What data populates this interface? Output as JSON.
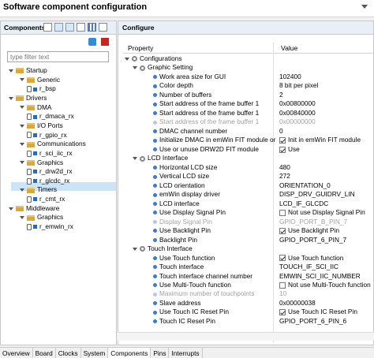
{
  "window": {
    "title": "Software component configuration"
  },
  "components": {
    "header": "Components",
    "filter_placeholder": "type filter text",
    "tree": [
      {
        "label": "Startup",
        "kind": "folder",
        "level": 1
      },
      {
        "label": "Generic",
        "kind": "folder",
        "level": 2
      },
      {
        "label": "r_bsp",
        "kind": "comp",
        "level": 3
      },
      {
        "label": "Drivers",
        "kind": "folder",
        "level": 1
      },
      {
        "label": "DMA",
        "kind": "folder",
        "level": 2
      },
      {
        "label": "r_dmaca_rx",
        "kind": "comp",
        "level": 3
      },
      {
        "label": "I/O Ports",
        "kind": "folder",
        "level": 2
      },
      {
        "label": "r_gpio_rx",
        "kind": "comp",
        "level": 3
      },
      {
        "label": "Communications",
        "kind": "folder",
        "level": 2
      },
      {
        "label": "r_sci_iic_rx",
        "kind": "comp",
        "level": 3
      },
      {
        "label": "Graphics",
        "kind": "folder",
        "level": 2
      },
      {
        "label": "r_drw2d_rx",
        "kind": "comp",
        "level": 3
      },
      {
        "label": "r_glcdc_rx",
        "kind": "comp",
        "level": 3
      },
      {
        "label": "Timers",
        "kind": "folder",
        "level": 2,
        "selected": true
      },
      {
        "label": "r_cmt_rx",
        "kind": "comp",
        "level": 3
      },
      {
        "label": "Middleware",
        "kind": "folder",
        "level": 1
      },
      {
        "label": "Graphics",
        "kind": "folder",
        "level": 2
      },
      {
        "label": "r_emwin_rx",
        "kind": "comp",
        "level": 3
      }
    ]
  },
  "configure": {
    "header": "Configure",
    "col_property": "Property",
    "col_value": "Value",
    "rows": [
      {
        "label": "Configurations",
        "type": "group",
        "level": 0
      },
      {
        "label": "Graphic Setting",
        "type": "group",
        "level": 1
      },
      {
        "label": "Work area size for GUI",
        "value": "102400",
        "level": 2
      },
      {
        "label": "Color depth",
        "value": "8 bit per pixel",
        "level": 2
      },
      {
        "label": "Number of buffers",
        "value": "2",
        "level": 2
      },
      {
        "label": "Start address of the frame buffer 1",
        "value": "0x00800000",
        "level": 2
      },
      {
        "label": "Start address of the frame buffer 1",
        "value": "0x00840000",
        "level": 2
      },
      {
        "label": "Start address of the frame buffer 1",
        "value": "0x00000000",
        "level": 2,
        "disabled": true
      },
      {
        "label": "DMAC channel number",
        "value": "0",
        "level": 2
      },
      {
        "label": "Initialize DMAC in emWin FIT module or not",
        "value": "Init in emWin FIT module",
        "checkbox": true,
        "checked": true,
        "level": 2
      },
      {
        "label": "Use or unuse DRW2D FIT module",
        "value": "Use",
        "checkbox": true,
        "checked": true,
        "level": 2
      },
      {
        "label": "LCD Interface",
        "type": "group",
        "level": 1
      },
      {
        "label": "Horizontal LCD size",
        "value": "480",
        "level": 2
      },
      {
        "label": "Vertical LCD size",
        "value": "272",
        "level": 2
      },
      {
        "label": "LCD orientation",
        "value": "ORIENTATION_0",
        "level": 2
      },
      {
        "label": "emWin display driver",
        "value": "DISP_DRV_GUIDRV_LIN",
        "level": 2
      },
      {
        "label": "LCD interface",
        "value": "LCD_IF_GLCDC",
        "level": 2
      },
      {
        "label": "Use Display Signal Pin",
        "value": "Not use Display Signal Pin",
        "checkbox": true,
        "checked": false,
        "level": 2
      },
      {
        "label": "Display Signal Pin",
        "value": "GPIO_PORT_B_PIN_7",
        "level": 2,
        "disabled": true
      },
      {
        "label": "Use Backlight Pin",
        "value": "Use Backlight Pin",
        "checkbox": true,
        "checked": true,
        "level": 2
      },
      {
        "label": "Backlight Pin",
        "value": "GPIO_PORT_6_PIN_7",
        "level": 2
      },
      {
        "label": "Touch Interface",
        "type": "group",
        "level": 1
      },
      {
        "label": "Use Touch function",
        "value": "Use Touch function",
        "checkbox": true,
        "checked": true,
        "level": 2
      },
      {
        "label": "Touch interface",
        "value": "TOUCH_IF_SCI_IIC",
        "level": 2
      },
      {
        "label": "Touch interface channel number",
        "value": "EMWIN_SCI_IIC_NUMBER",
        "level": 2
      },
      {
        "label": "Use Multi-Touch function",
        "value": "Not use Multi-Touch function",
        "checkbox": true,
        "checked": false,
        "level": 2
      },
      {
        "label": "Maximum number of touchpoints",
        "value": "10",
        "level": 2,
        "disabled": true
      },
      {
        "label": "Slave address",
        "value": "0x00000038",
        "level": 2
      },
      {
        "label": "Use Touch IC Reset Pin",
        "value": "Use Touch IC Reset Pin",
        "checkbox": true,
        "checked": true,
        "level": 2
      },
      {
        "label": "Touch IC Reset Pin",
        "value": "GPIO_PORT_6_PIN_6",
        "level": 2
      }
    ]
  },
  "tabs": [
    "Overview",
    "Board",
    "Clocks",
    "System",
    "Components",
    "Pins",
    "Interrupts"
  ],
  "active_tab": "Components",
  "icons": [
    "add-component-icon",
    "remove-component-icon",
    "collapse-icon",
    "expand-icon",
    "generate-icon"
  ],
  "colors": {
    "header_bg": "#e9eff7",
    "selection": "#cce4fa",
    "bullet": "#3a7bd5"
  }
}
